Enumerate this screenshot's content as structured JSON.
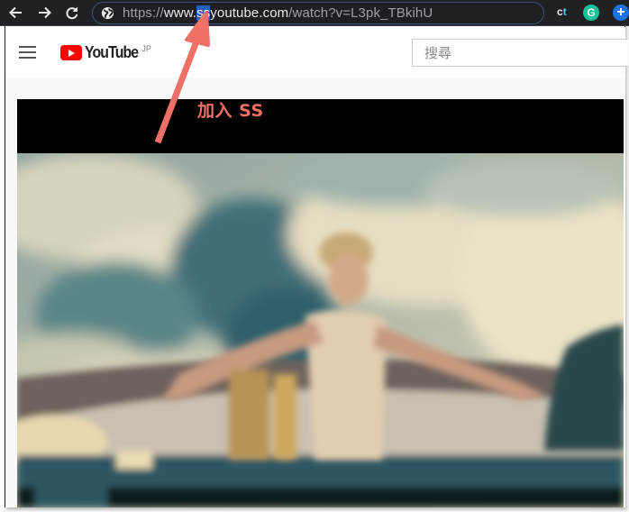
{
  "browser": {
    "nav": {
      "back_icon": "arrow-left-icon",
      "forward_icon": "arrow-right-icon",
      "reload_icon": "reload-icon"
    },
    "omnibox": {
      "site_icon": "globe-icon",
      "url_scheme": "https://",
      "url_host_prefix": "www.",
      "url_highlight": "ss",
      "url_host_rest": "youtube.com",
      "url_path": "/watch?v=L3pk_TBkihU"
    },
    "extensions": [
      {
        "name": "ct-extension",
        "label_main": "c",
        "label_accent": "t"
      },
      {
        "name": "grammarly-extension",
        "label": "G",
        "color": "#15c39a"
      },
      {
        "name": "add-extension",
        "label": "+",
        "color": "#1a73e8"
      }
    ]
  },
  "youtube": {
    "menu_icon": "hamburger-menu-icon",
    "logo_text": "YouTube",
    "logo_region": "JP",
    "search_placeholder": "搜尋"
  },
  "player": {
    "description": "Video frame: woman standing at the stern of a speedboat with white-water wake behind"
  },
  "annotation": {
    "label": "加入 SS",
    "color": "#f07068",
    "arrow_target": "url-highlight"
  }
}
